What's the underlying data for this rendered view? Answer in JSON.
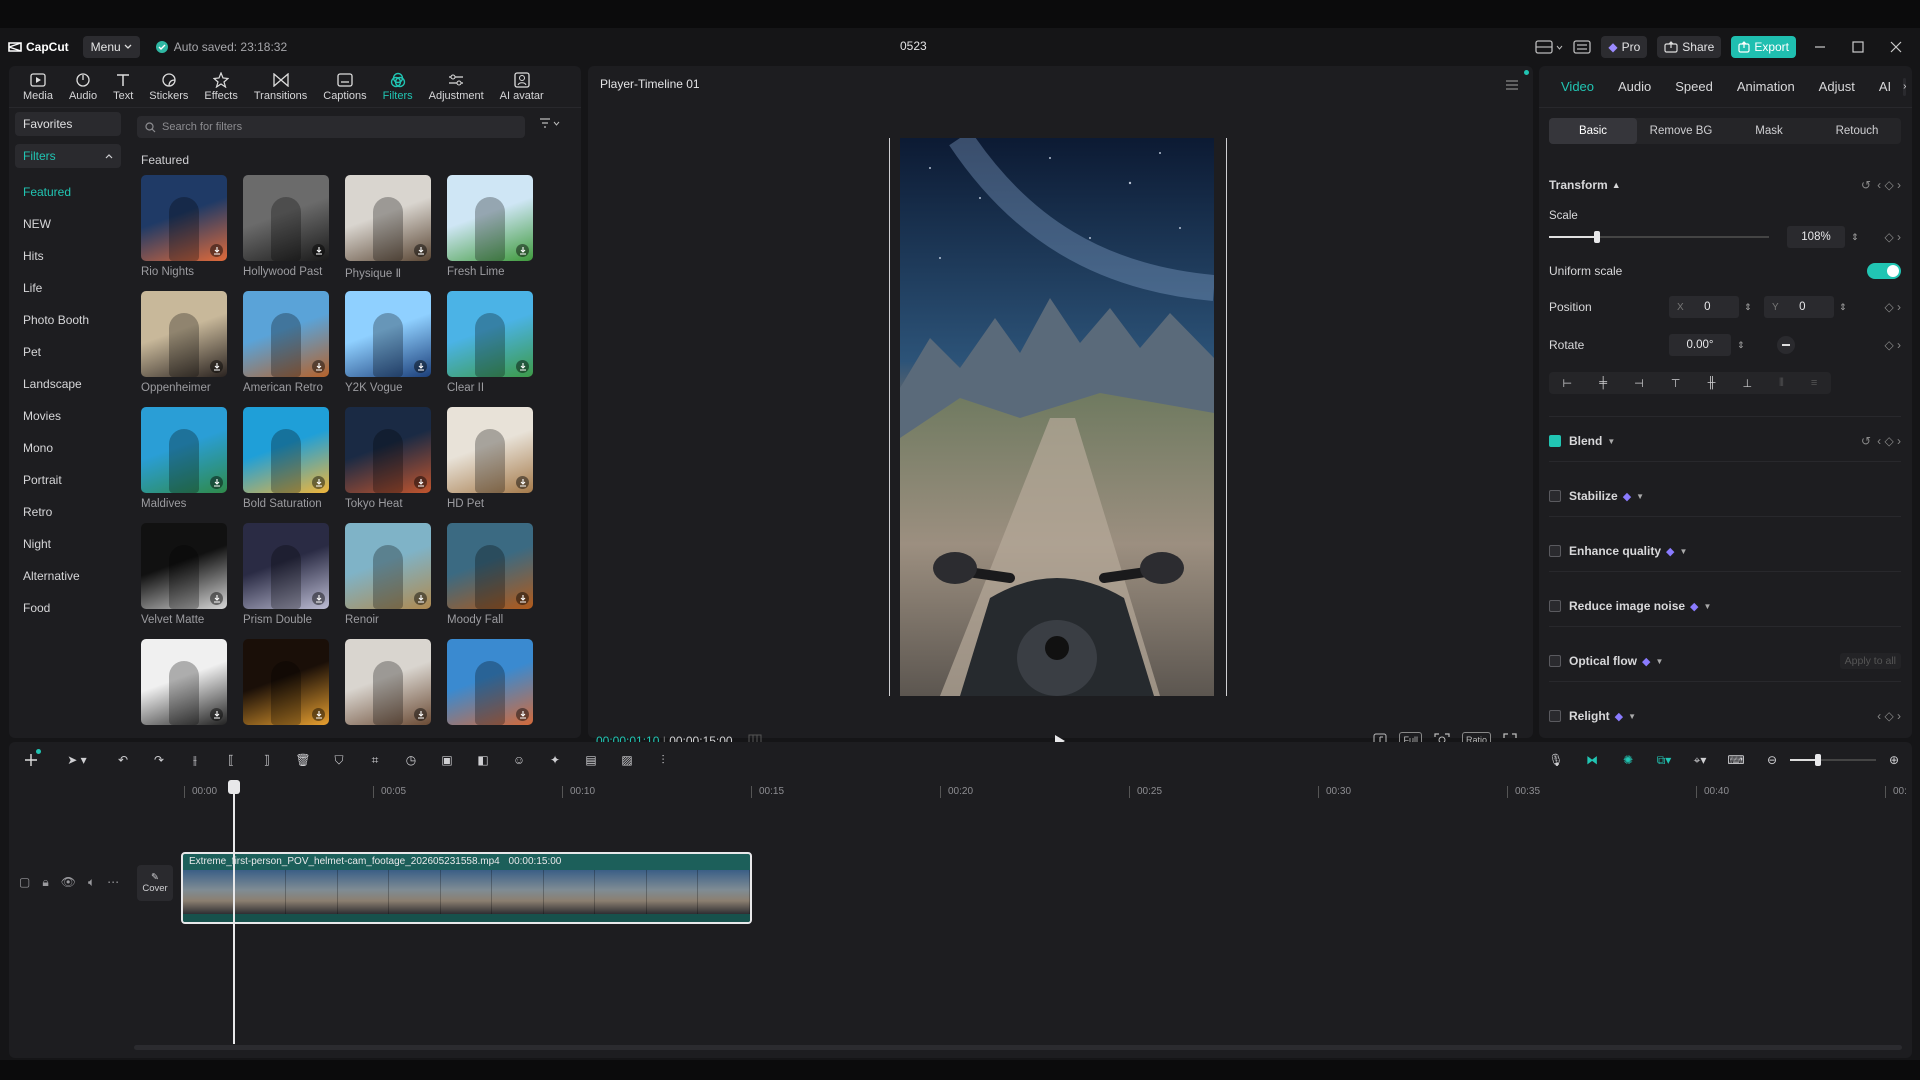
{
  "topbar": {
    "logo": "CapCut",
    "menu": "Menu",
    "autosave": "Auto saved: 23:18:32",
    "project": "0523",
    "pro": "Pro",
    "share": "Share",
    "export": "Export"
  },
  "tools": [
    {
      "label": "Media",
      "icon": "media-icon"
    },
    {
      "label": "Audio",
      "icon": "audio-icon"
    },
    {
      "label": "Text",
      "icon": "text-icon"
    },
    {
      "label": "Stickers",
      "icon": "stickers-icon"
    },
    {
      "label": "Effects",
      "icon": "effects-icon"
    },
    {
      "label": "Transitions",
      "icon": "transitions-icon"
    },
    {
      "label": "Captions",
      "icon": "captions-icon"
    },
    {
      "label": "Filters",
      "icon": "filters-icon"
    },
    {
      "label": "Adjustment",
      "icon": "adjustment-icon"
    },
    {
      "label": "AI avatar",
      "icon": "ai-avatar-icon"
    }
  ],
  "sidebar": {
    "favorites": "Favorites",
    "filters": "Filters",
    "items": [
      "Featured",
      "NEW",
      "Hits",
      "Life",
      "Photo Booth",
      "Pet",
      "Landscape",
      "Movies",
      "Mono",
      "Portrait",
      "Retro",
      "Night",
      "Alternative",
      "Food"
    ]
  },
  "search": {
    "placeholder": "Search for filters"
  },
  "section": "Featured",
  "filters": [
    {
      "name": "Rio Nights",
      "c1": "#1f3a66",
      "c2": "#e06a3a"
    },
    {
      "name": "Hollywood Past",
      "c1": "#6b6b6b",
      "c2": "#1a1a1a"
    },
    {
      "name": "Physique Ⅱ",
      "c1": "#d9d5cf",
      "c2": "#5a4634"
    },
    {
      "name": "Fresh Lime",
      "c1": "#cfe6f5",
      "c2": "#3f9a3c"
    },
    {
      "name": "Oppenheimer",
      "c1": "#c8b89a",
      "c2": "#2a2320"
    },
    {
      "name": "American Retro",
      "c1": "#5aa3d8",
      "c2": "#b5622b"
    },
    {
      "name": "Y2K Vogue",
      "c1": "#8fd0ff",
      "c2": "#1c3f7a"
    },
    {
      "name": "Clear II",
      "c1": "#4bb3e6",
      "c2": "#3d9a48"
    },
    {
      "name": "Maldives",
      "c1": "#2a9ed6",
      "c2": "#2f8a4a"
    },
    {
      "name": "Bold Saturation",
      "c1": "#1f9fd8",
      "c2": "#f0b53a"
    },
    {
      "name": "Tokyo Heat",
      "c1": "#1a2a44",
      "c2": "#c2552e"
    },
    {
      "name": "HD Pet",
      "c1": "#e8e2d8",
      "c2": "#a57a4a"
    },
    {
      "name": "Velvet Matte",
      "c1": "#111111",
      "c2": "#d8d8d8"
    },
    {
      "name": "Prism Double",
      "c1": "#2a2b44",
      "c2": "#bdbdd4"
    },
    {
      "name": "Renoir",
      "c1": "#7fb3c7",
      "c2": "#b08a4f"
    },
    {
      "name": "Moody Fall",
      "c1": "#3b6a82",
      "c2": "#b25a1a"
    },
    {
      "name": "",
      "c1": "#f0f0f0",
      "c2": "#222222"
    },
    {
      "name": "",
      "c1": "#1a0f08",
      "c2": "#e8a030"
    },
    {
      "name": "",
      "c1": "#d9d5cf",
      "c2": "#6a4a34"
    },
    {
      "name": "",
      "c1": "#3a8ad0",
      "c2": "#d46a3a"
    }
  ],
  "player": {
    "title": "Player-Timeline 01",
    "current": "00:00:01:10",
    "total": "00:00:15:00",
    "full": "Full",
    "ratio": "Ratio"
  },
  "inspector": {
    "tabs": [
      "Video",
      "Audio",
      "Speed",
      "Animation",
      "Adjust",
      "AI"
    ],
    "subtabs": [
      "Basic",
      "Remove BG",
      "Mask",
      "Retouch"
    ],
    "transform": "Transform",
    "scale_label": "Scale",
    "scale_value": "108%",
    "scale_fraction": 0.22,
    "uniform_scale": "Uniform scale",
    "position": "Position",
    "pos_x_label": "X",
    "pos_x": "0",
    "pos_y_label": "Y",
    "pos_y": "0",
    "rotate": "Rotate",
    "rotate_value": "0.00°",
    "blend": "Blend",
    "stabilize": "Stabilize",
    "enhance": "Enhance quality",
    "noise": "Reduce image noise",
    "optical": "Optical flow",
    "apply_all": "Apply to all",
    "relight": "Relight"
  },
  "timeline": {
    "ruler": [
      "00:00",
      "00:05",
      "00:10",
      "00:15",
      "00:20",
      "00:25",
      "00:30",
      "00:35",
      "00:40",
      "00:"
    ],
    "clip_name": "Extreme_first-person_POV_helmet-cam_footage_202605231558.mp4",
    "clip_duration": "00:00:15:00",
    "cover": "Cover",
    "zoom_fraction": 0.32
  },
  "colors": {
    "accent": "#21c5b3",
    "panel": "#1d1d20",
    "bg": "#151517"
  }
}
